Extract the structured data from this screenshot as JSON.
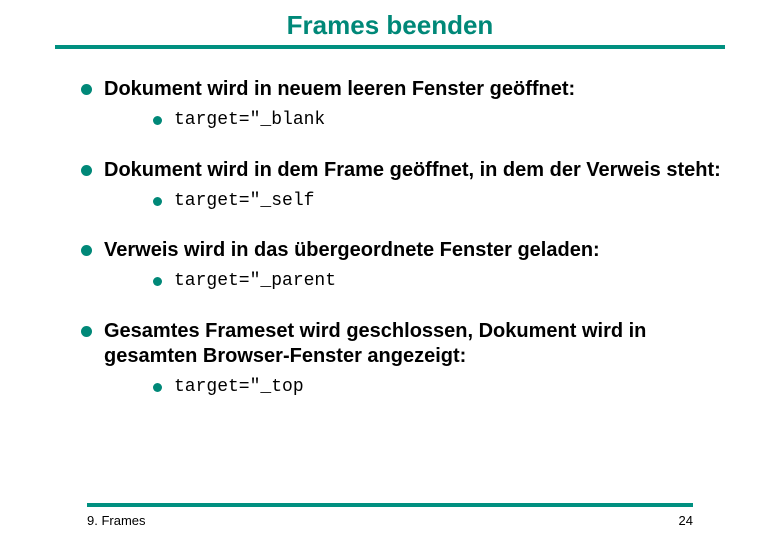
{
  "title": "Frames beenden",
  "items": [
    {
      "text": "Dokument wird in neuem leeren Fenster geöffnet:",
      "code": "target=\"_blank"
    },
    {
      "text": "Dokument wird in dem Frame geöffnet, in dem der Verweis steht:",
      "code": "target=\"_self"
    },
    {
      "text": "Verweis wird in das übergeordnete Fenster geladen:",
      "code": "target=\"_parent"
    },
    {
      "text": "Gesamtes Frameset wird geschlossen, Dokument wird in gesamten Browser-Fenster angezeigt:",
      "code": "target=\"_top"
    }
  ],
  "footer": {
    "left": "9. Frames",
    "right": "24"
  }
}
